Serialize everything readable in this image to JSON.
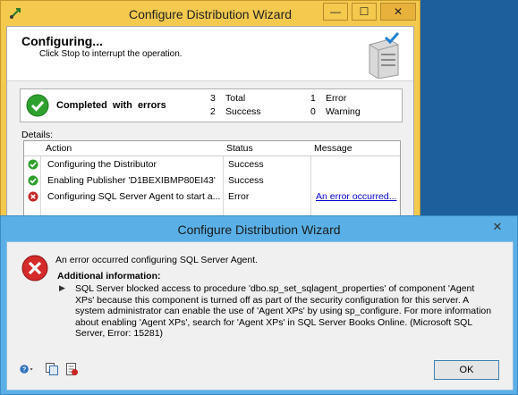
{
  "wizard": {
    "title": "Configure Distribution Wizard",
    "buttons": {
      "minimize": "—",
      "maximize": "☐",
      "close": "✕"
    },
    "header": {
      "title": "Configuring...",
      "subtitle": "Click Stop to interrupt the operation."
    },
    "summary": {
      "status": "Completed with errors",
      "total_count": "3",
      "total_label": "Total",
      "success_count": "2",
      "success_label": "Success",
      "error_count": "1",
      "error_label": "Error",
      "warning_count": "0",
      "warning_label": "Warning"
    },
    "details_label": "Details:",
    "columns": [
      "Action",
      "Status",
      "Message"
    ],
    "rows": [
      {
        "action": "Configuring the Distributor",
        "status": "Success",
        "message": "",
        "icon": "success-icon"
      },
      {
        "action": "Enabling Publisher 'D1BEXIBMP80EI43'",
        "status": "Success",
        "message": "",
        "icon": "success-icon"
      },
      {
        "action": "Configuring SQL Server Agent to start a...",
        "status": "Error",
        "message": "An error occurred...",
        "icon": "error-icon"
      }
    ]
  },
  "dialog": {
    "title": "Configure Distribution Wizard",
    "close": "✕",
    "message": "An error occurred configuring SQL Server Agent.",
    "additional_label": "Additional information:",
    "arrow": "▶",
    "detail": "SQL Server blocked access to procedure 'dbo.sp_set_sqlagent_properties' of component 'Agent XPs' because this component is turned off as part of the security configuration for this server. A system administrator can enable the use of 'Agent XPs' by using sp_configure. For more information about enabling 'Agent XPs', search for 'Agent XPs' in SQL Server Books Online. (Microsoft SQL Server, Error: 15281)",
    "ok_label": "OK"
  },
  "colors": {
    "desktop": "#1c5f9c",
    "wizard_frame": "#f3c94e",
    "dialog_frame": "#5ab0e6",
    "success": "#2ea02e",
    "error": "#c82424",
    "link": "#0000cc"
  }
}
